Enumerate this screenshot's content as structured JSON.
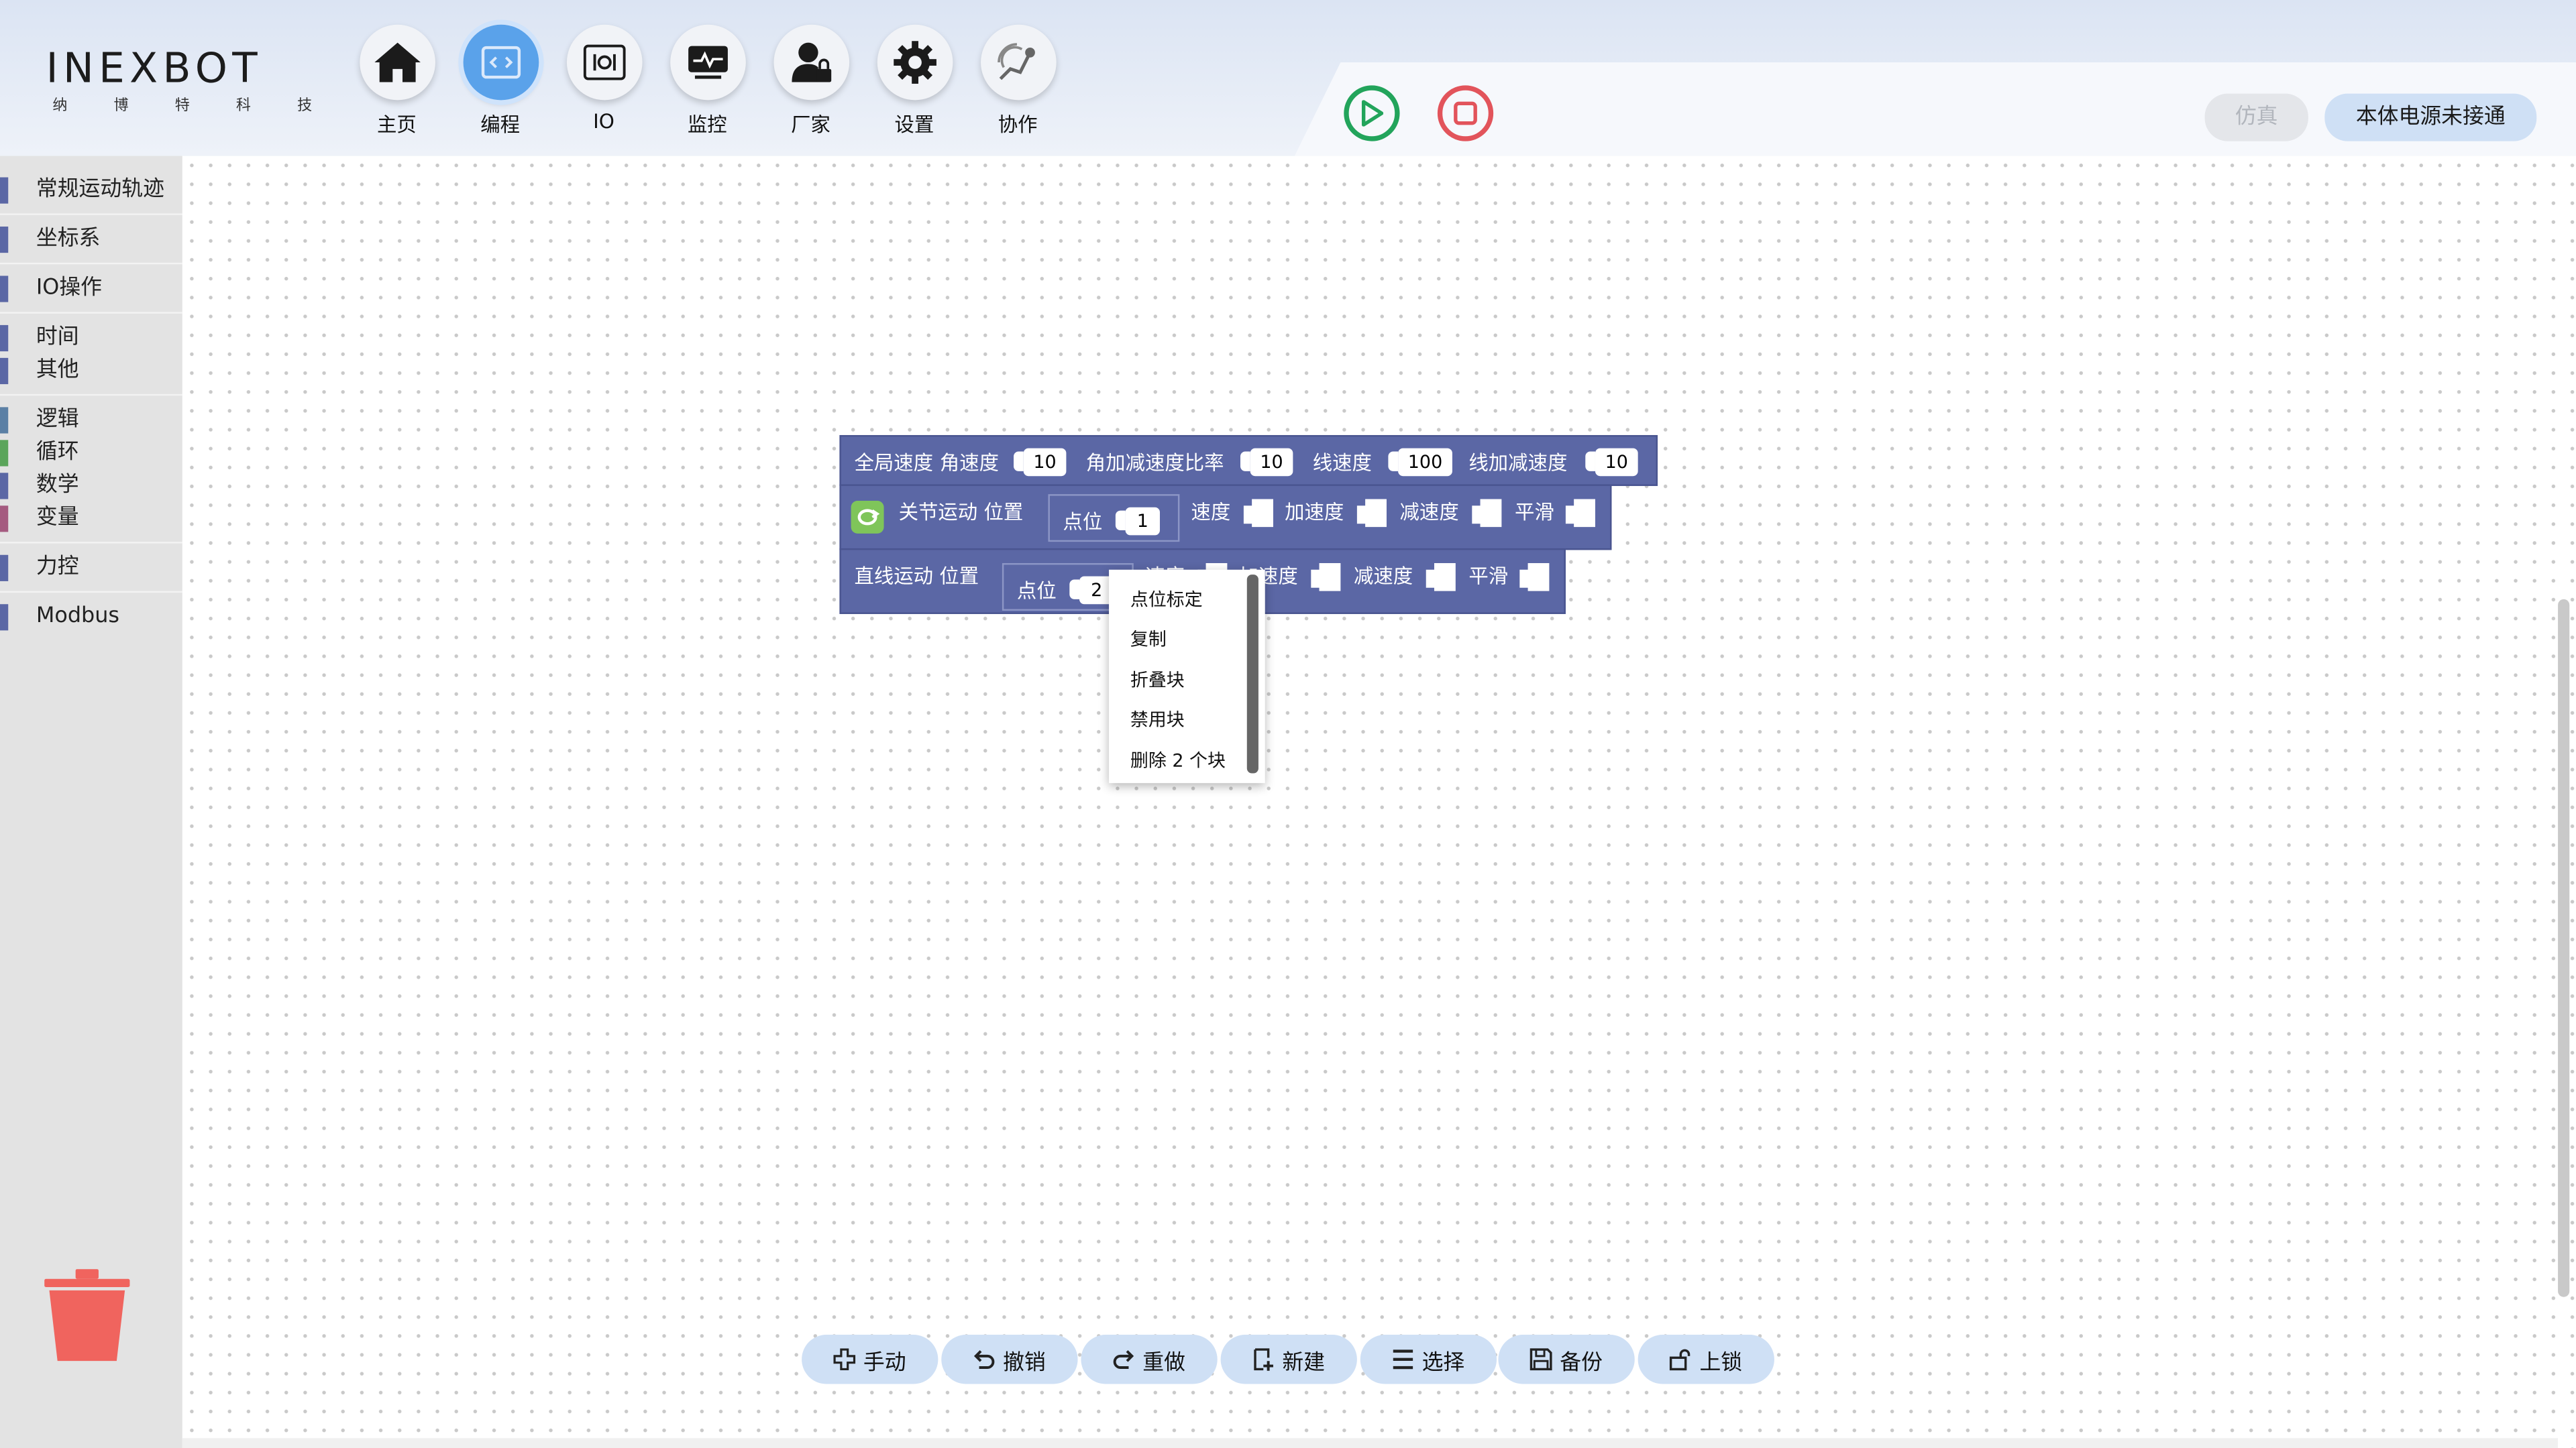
{
  "logo": {
    "main": "INEXBOT",
    "sub": [
      "纳",
      "博",
      "特",
      "科",
      "技"
    ]
  },
  "nav": [
    {
      "label": "主页",
      "icon": "home-icon"
    },
    {
      "label": "编程",
      "icon": "code-icon"
    },
    {
      "label": "IO",
      "icon": "io-icon"
    },
    {
      "label": "监控",
      "icon": "monitor-icon"
    },
    {
      "label": "厂家",
      "icon": "vendor-icon"
    },
    {
      "label": "设置",
      "icon": "gear-icon"
    },
    {
      "label": "协作",
      "icon": "cooperate-icon"
    }
  ],
  "header": {
    "run_icon": "play-icon",
    "stop_icon": "stop-icon",
    "sim_label": "仿真",
    "power_label": "本体电源未接通"
  },
  "sidebar": {
    "items": [
      {
        "label": "常规运动轨迹",
        "color": "#5b67a5"
      },
      {
        "label": "坐标系",
        "color": "#5b67a5"
      },
      {
        "label": "IO操作",
        "color": "#5b67a5"
      },
      {
        "label": "时间",
        "color": "#5b67a5"
      },
      {
        "label": "其他",
        "color": "#5b67a5"
      },
      {
        "label": "逻辑",
        "color": "#5b80a5"
      },
      {
        "label": "循环",
        "color": "#5ba55b"
      },
      {
        "label": "数学",
        "color": "#5b67a5"
      },
      {
        "label": "变量",
        "color": "#a55b80"
      },
      {
        "label": "力控",
        "color": "#5b67a5"
      },
      {
        "label": "Modbus",
        "color": "#5b67a5"
      }
    ],
    "trash_icon": "trash-icon"
  },
  "blocks": {
    "global_speed": {
      "title": "全局速度",
      "angle_speed_label": "角速度",
      "angle_speed": "10",
      "angle_acc_ratio_label": "角加减速度比率",
      "angle_acc_ratio": "10",
      "line_speed_label": "线速度",
      "line_speed": "100",
      "line_acc_label": "线加减速度",
      "line_acc": "10"
    },
    "joint_move": {
      "title": "关节运动 位置",
      "point_label": "点位",
      "point": "1",
      "speed_label": "速度",
      "acc_label": "加速度",
      "dec_label": "减速度",
      "smooth_label": "平滑"
    },
    "linear_move": {
      "title": "直线运动 位置",
      "point_label": "点位",
      "point": "2",
      "speed_label": "速度",
      "acc_label": "加速度",
      "dec_label": "减速度",
      "smooth_label": "平滑"
    }
  },
  "context_menu": [
    "点位标定",
    "复制",
    "折叠块",
    "禁用块",
    "删除 2 个块"
  ],
  "toolbar": [
    {
      "label": "手动",
      "icon": "manual-icon"
    },
    {
      "label": "撤销",
      "icon": "undo-icon"
    },
    {
      "label": "重做",
      "icon": "redo-icon"
    },
    {
      "label": "新建",
      "icon": "new-icon"
    },
    {
      "label": "选择",
      "icon": "select-icon"
    },
    {
      "label": "备份",
      "icon": "save-icon"
    },
    {
      "label": "上锁",
      "icon": "lock-icon"
    }
  ]
}
